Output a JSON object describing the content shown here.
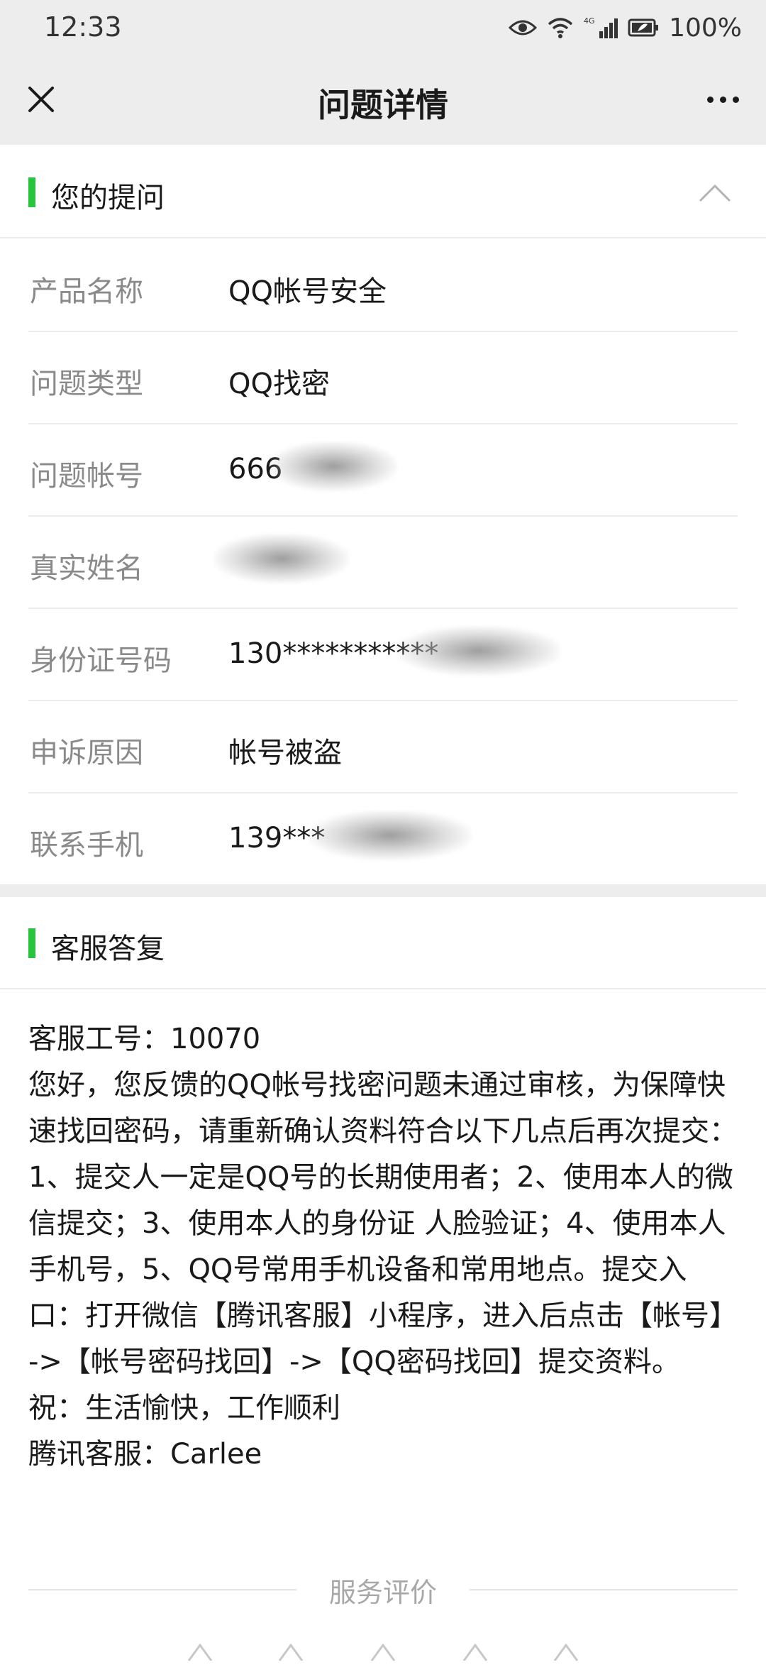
{
  "status_bar": {
    "time": "12:33",
    "network": "4G",
    "battery": "100%",
    "icons": [
      "eye-icon",
      "wifi-icon",
      "signal-icon",
      "battery-icon"
    ]
  },
  "header": {
    "title": "问题详情",
    "close_icon": "close-icon",
    "more_icon": "more-icon"
  },
  "question_section": {
    "title": "您的提问",
    "collapse_icon": "chevron-up-icon",
    "rows": [
      {
        "label": "产品名称",
        "value": "QQ帐号安全"
      },
      {
        "label": "问题类型",
        "value": "QQ找密"
      },
      {
        "label": "问题帐号",
        "value": "666"
      },
      {
        "label": "真实姓名",
        "value": ""
      },
      {
        "label": "身份证号码",
        "value": "130***********"
      },
      {
        "label": "申诉原因",
        "value": "帐号被盗"
      },
      {
        "label": "联系手机",
        "value": "139***"
      }
    ]
  },
  "reply_section": {
    "title": "客服答复",
    "lines": [
      "客服工号：10070",
      "您好，您反馈的QQ帐号找密问题未通过审核，为保障快速找回密码，请重新确认资料符合以下几点后再次提交：1、提交人一定是QQ号的长期使用者；2、使用本人的微信提交；3、使用本人的身份证 人脸验证；4、使用本人手机号，5、QQ号常用手机设备和常用地点。提交入口：打开微信【腾讯客服】小程序，进入后点击【帐号】->【帐号密码找回】->【QQ密码找回】提交资料。",
      "祝：生活愉快，工作顺利",
      "腾讯客服：Carlee"
    ]
  },
  "rating": {
    "title": "服务评价",
    "star_count": 5
  },
  "colors": {
    "accent_green": "#27c53e",
    "header_bg": "#ededed",
    "label_gray": "#8a8a8a"
  }
}
